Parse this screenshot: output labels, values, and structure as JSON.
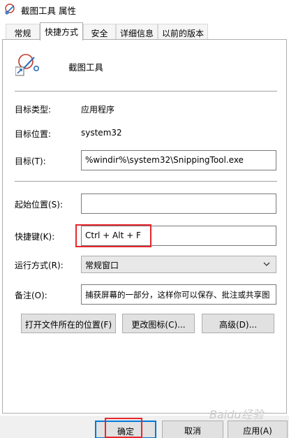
{
  "window": {
    "title": "截图工具 属性",
    "icon": "snipping-tool-icon"
  },
  "tabs": [
    {
      "label": "常规",
      "active": false
    },
    {
      "label": "快捷方式",
      "active": true
    },
    {
      "label": "安全",
      "active": false
    },
    {
      "label": "详细信息",
      "active": false
    },
    {
      "label": "以前的版本",
      "active": false
    }
  ],
  "app": {
    "name": "截图工具",
    "icon": "scissors-shortcut-icon"
  },
  "fields": {
    "target_type_label": "目标类型:",
    "target_type_value": "应用程序",
    "target_location_label": "目标位置:",
    "target_location_value": "system32",
    "target_label": "目标(T):",
    "target_value": "%windir%\\system32\\SnippingTool.exe",
    "start_in_label": "起始位置(S):",
    "start_in_value": "",
    "hotkey_label": "快捷键(K):",
    "hotkey_value": "Ctrl + Alt + F",
    "run_label": "运行方式(R):",
    "run_value": "常规窗口",
    "comment_label": "备注(O):",
    "comment_value": "捕获屏幕的一部分，这样你可以保存、批注或共享图"
  },
  "buttons": {
    "open_location": "打开文件所在的位置(F)",
    "change_icon": "更改图标(C)...",
    "advanced": "高级(D)..."
  },
  "dialog_buttons": {
    "ok": "确定",
    "cancel": "取消",
    "apply": "应用(A)"
  },
  "watermark": "Baidu经验",
  "colors": {
    "highlight": "#e8262b",
    "default_border": "#0078d7"
  }
}
